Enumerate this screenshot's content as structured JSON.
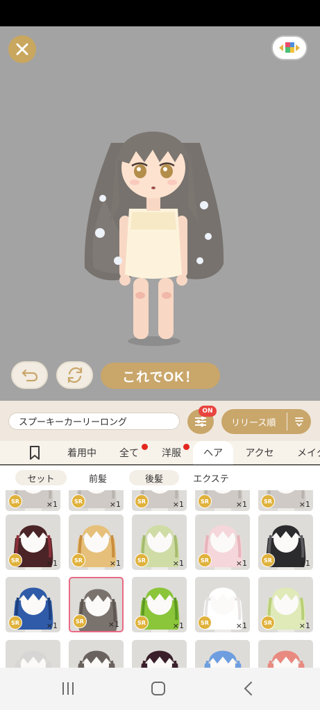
{
  "header": {
    "close_icon": "close-icon",
    "palette_icon": "color-palette-icon"
  },
  "preview": {
    "undo_icon": "undo-icon",
    "rotate_icon": "rotate-icon",
    "ok_label": "これでOK！",
    "background_color": "#a3a3a3",
    "accent_color": "#c9a66a"
  },
  "toolbar": {
    "search_value": "スプーキーカーリーロング",
    "filter_icon": "filter-sliders-icon",
    "filter_badge": "ON",
    "sort_label": "リリース順",
    "sort_icon": "sort-order-icon"
  },
  "tabs": [
    {
      "label": "",
      "icon": "bookmark-icon",
      "active": false,
      "dot": false
    },
    {
      "label": "着用中",
      "active": false,
      "dot": false
    },
    {
      "label": "全て",
      "active": false,
      "dot": true
    },
    {
      "label": "洋服",
      "active": false,
      "dot": true
    },
    {
      "label": "ヘア",
      "active": true,
      "dot": false
    },
    {
      "label": "アクセ",
      "active": false,
      "dot": false
    },
    {
      "label": "メイク",
      "active": false,
      "dot": false
    }
  ],
  "subtabs": [
    {
      "label": "セット",
      "pill": true
    },
    {
      "label": "前髪",
      "pill": false
    },
    {
      "label": "後髪",
      "pill": true
    },
    {
      "label": "エクステ",
      "pill": false
    }
  ],
  "items": {
    "rarity": "SR",
    "count": "×1",
    "rows": [
      [
        {
          "hair_color": "#4a2426",
          "accent": "#8a2f3a",
          "selected": false
        },
        {
          "hair_color": "#e6c07a",
          "accent": "#c98e3e",
          "selected": false
        },
        {
          "hair_color": "#cfdca6",
          "accent": "#a5bb6e",
          "selected": false
        },
        {
          "hair_color": "#f5d6da",
          "accent": "#e7b3ba",
          "selected": false
        },
        {
          "hair_color": "#2b2b2e",
          "accent": "#5a5a5e",
          "selected": false
        }
      ],
      [
        {
          "hair_color": "#2f5ba8",
          "accent": "#1c3f80",
          "selected": false
        },
        {
          "hair_color": "#7a726d",
          "accent": "#5f5752",
          "selected": true
        },
        {
          "hair_color": "#8ac53a",
          "accent": "#5d9a21",
          "selected": false
        },
        {
          "hair_color": "#ffffff",
          "accent": "#e8e4e4",
          "selected": false
        },
        {
          "hair_color": "#dfeab8",
          "accent": "#b9cf77",
          "selected": false
        }
      ]
    ]
  },
  "navbar": {
    "recents_icon": "recent-apps-icon",
    "home_icon": "home-icon",
    "back_icon": "back-icon"
  }
}
